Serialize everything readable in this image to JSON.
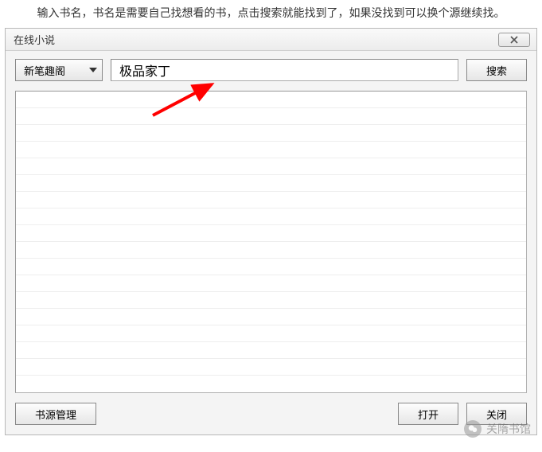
{
  "instruction": "输入书名，书名是需要自己找想看的书，点击搜索就能找到了，如果没找到可以换个源继续找。",
  "window": {
    "title": "在线小说",
    "source_selected": "新笔趣阁",
    "search_value": "极品家丁",
    "search_button": "搜索",
    "manage_sources_button": "书源管理",
    "open_button": "打开",
    "close_button": "关闭"
  },
  "watermark": {
    "text": "关隋书馆"
  },
  "colors": {
    "arrow": "#ff0000"
  }
}
